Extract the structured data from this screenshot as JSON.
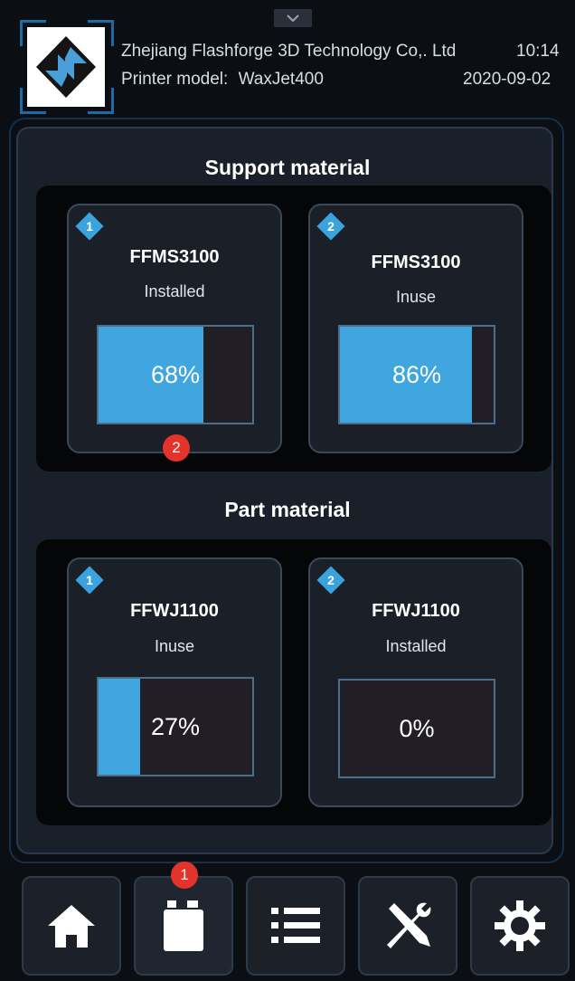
{
  "header": {
    "company": "Zhejiang Flashforge 3D Technology Co,. Ltd",
    "time": "10:14",
    "model_label": "Printer model:",
    "model_value": "WaxJet400",
    "date": "2020-09-02"
  },
  "support": {
    "title": "Support material",
    "cards": [
      {
        "index": "1",
        "name": "FFMS3100",
        "status": "Installed",
        "percent_text": "68%",
        "level": 0.68
      },
      {
        "index": "2",
        "name": "FFMS3100",
        "status": "Inuse",
        "percent_text": "86%",
        "level": 0.86
      }
    ]
  },
  "part": {
    "title": "Part material",
    "cards": [
      {
        "index": "1",
        "name": "FFWJ1100",
        "status": "Inuse",
        "percent_text": "27%",
        "level": 0.27
      },
      {
        "index": "2",
        "name": "FFWJ1100",
        "status": "Installed",
        "percent_text": "0%",
        "level": 0
      }
    ]
  },
  "badges": {
    "materials_nav": "1",
    "support_card": "2"
  },
  "nav": {
    "items": [
      {
        "icon": "home-icon"
      },
      {
        "icon": "material-bottle-icon"
      },
      {
        "icon": "list-icon"
      },
      {
        "icon": "tools-icon"
      },
      {
        "icon": "gear-icon"
      }
    ]
  },
  "colors": {
    "accent": "#3fa6df",
    "badge": "#e3332a",
    "background": "#0b0e13"
  }
}
